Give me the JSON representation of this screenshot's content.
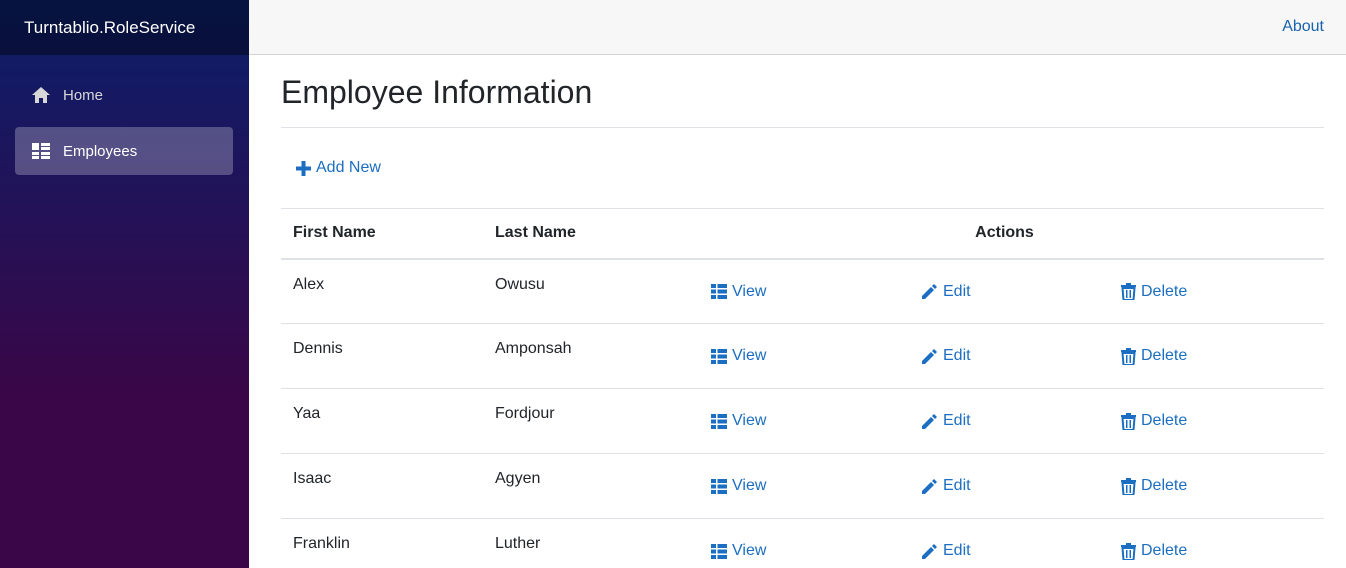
{
  "app": {
    "title": "Turntablio.RoleService"
  },
  "sidebar": {
    "items": [
      {
        "label": "Home",
        "icon": "home-icon",
        "active": false
      },
      {
        "label": "Employees",
        "icon": "list-icon",
        "active": true
      }
    ]
  },
  "topbar": {
    "about_label": "About"
  },
  "page": {
    "title": "Employee Information",
    "add_new_label": "Add New"
  },
  "table": {
    "headers": {
      "first_name": "First Name",
      "last_name": "Last Name",
      "actions": "Actions"
    },
    "action_labels": {
      "view": "View",
      "edit": "Edit",
      "delete": "Delete"
    },
    "rows": [
      {
        "first": "Alex",
        "last": "Owusu"
      },
      {
        "first": "Dennis",
        "last": "Amponsah"
      },
      {
        "first": "Yaa",
        "last": "Fordjour"
      },
      {
        "first": "Isaac",
        "last": "Agyen"
      },
      {
        "first": "Franklin",
        "last": "Luther"
      }
    ]
  },
  "colors": {
    "link": "#1b6ec2",
    "sidebar_top": "#0a1f6a",
    "sidebar_bottom": "#3a0647"
  }
}
